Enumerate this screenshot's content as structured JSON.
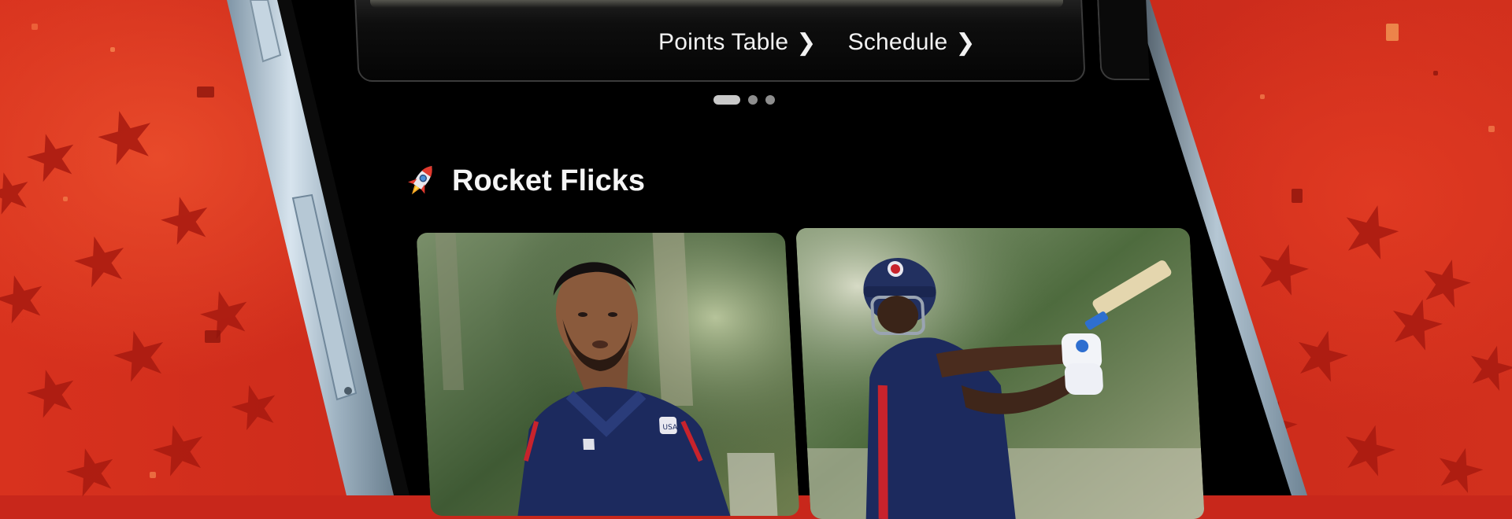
{
  "colors": {
    "background_red": "#c8271b",
    "star_red": "#a81a10",
    "phone_frame": "#a9bfcf",
    "screen_black": "#000000",
    "jersey_navy": "#1c2a5e"
  },
  "top_card": {
    "links": [
      {
        "label": "Points Table",
        "icon": "chevron-right-icon"
      },
      {
        "label": "Schedule",
        "icon": "chevron-right-icon"
      }
    ]
  },
  "carousel": {
    "dots": 3,
    "active_index": 0
  },
  "section": {
    "icon": "rocket-icon",
    "title": "Rocket Flicks"
  },
  "flicks": [
    {
      "subject": "player-portrait",
      "jersey_logo": "USA"
    },
    {
      "subject": "batsman-playing-shot"
    }
  ]
}
